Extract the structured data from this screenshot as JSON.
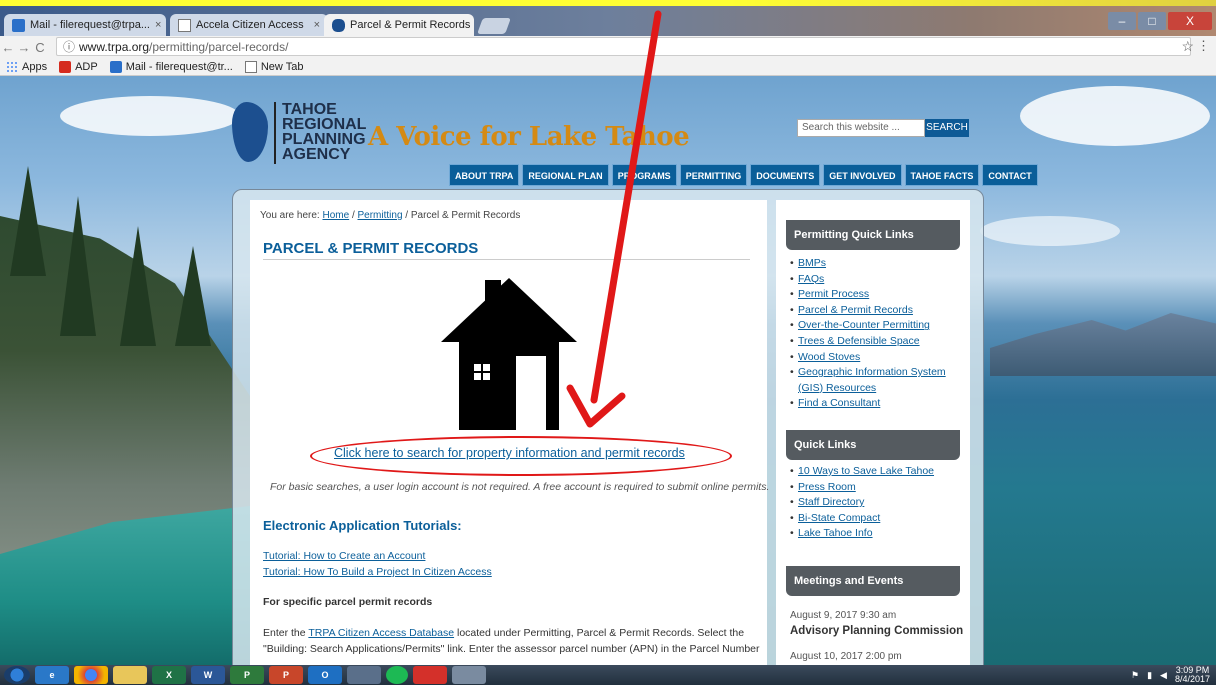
{
  "browser": {
    "tabs": [
      {
        "label": "Mail - filerequest@trpa...",
        "icon": "outlook-icon",
        "active": false
      },
      {
        "label": "Accela Citizen Access",
        "icon": "page-icon",
        "active": false
      },
      {
        "label": "Parcel & Permit Records",
        "icon": "trpa-icon",
        "active": true
      }
    ],
    "close_glyph": "×",
    "url_host": "www.trpa.org",
    "url_path": "/permitting/parcel-records/",
    "bookmarks": [
      {
        "label": "Apps",
        "icon": "apps-grid-icon"
      },
      {
        "label": "ADP",
        "icon": "adp-icon"
      },
      {
        "label": "Mail - filerequest@tr...",
        "icon": "outlook-icon"
      },
      {
        "label": "New Tab",
        "icon": "page-icon"
      }
    ],
    "window_controls": {
      "minimize": "–",
      "maximize": "□",
      "close": "X"
    }
  },
  "site": {
    "logo_lines": [
      "TAHOE",
      "REGIONAL",
      "PLANNING",
      "AGENCY"
    ],
    "tagline": "A Voice for Lake Tahoe",
    "search_placeholder": "Search this website ...",
    "search_button": "SEARCH",
    "nav": [
      "ABOUT TRPA",
      "REGIONAL PLAN",
      "PROGRAMS",
      "PERMITTING",
      "DOCUMENTS",
      "GET INVOLVED",
      "TAHOE FACTS",
      "CONTACT"
    ]
  },
  "main": {
    "breadcrumb_prefix": "You are here:",
    "breadcrumb_home": "Home",
    "breadcrumb_sep": "/",
    "breadcrumb_permitting": "Permitting",
    "breadcrumb_current": "Parcel & Permit Records",
    "title": "PARCEL & PERMIT RECORDS",
    "search_link": "Click here to search for property information and permit records",
    "note": "For basic searches, a user login account is not required. A free account is required to submit online permits.",
    "tutorials_heading": "Electronic Application Tutorials:",
    "tutorial_1": "Tutorial: How to Create an Account",
    "tutorial_2": "Tutorial: How To Build a Project In Citizen Access",
    "specific_heading": "For specific parcel permit records",
    "para_start": "Enter the",
    "para_link": "TRPA Citizen Access Database",
    "para_rest": "located under Permitting, Parcel & Permit Records. Select the \"Building: Search Applications/Permits\" link. Enter the assessor parcel number (APN) in the Parcel Number"
  },
  "sidebar": {
    "permitting_heading": "Permitting Quick Links",
    "permitting_links": [
      "BMPs",
      "FAQs",
      "Permit Process",
      "Parcel & Permit Records",
      "Over-the-Counter Permitting",
      "Trees & Defensible Space",
      "Wood Stoves",
      "Geographic Information System (GIS) Resources",
      "Find a Consultant"
    ],
    "quick_heading": "Quick Links",
    "quick_links": [
      "10 Ways to Save Lake Tahoe",
      "Press Room",
      "Staff Directory",
      "Bi-State Compact",
      "Lake Tahoe Info"
    ],
    "meetings_heading": "Meetings and Events",
    "event_1_date": "August 9, 2017 9:30 am",
    "event_1_title": "Advisory Planning Commission",
    "event_2_date": "August 10, 2017 2:00 pm"
  },
  "taskbar": {
    "apps": [
      "start",
      "ie",
      "chrome",
      "explorer",
      "excel",
      "word",
      "project",
      "powerpoint",
      "outlook",
      "skype",
      "spotify",
      "acrobat",
      "paint"
    ],
    "time": "3:09 PM",
    "date": "8/4/2017"
  },
  "colors": {
    "annotation": "#e01818",
    "link": "#0b5f9a",
    "nav": "#0a5e99"
  }
}
